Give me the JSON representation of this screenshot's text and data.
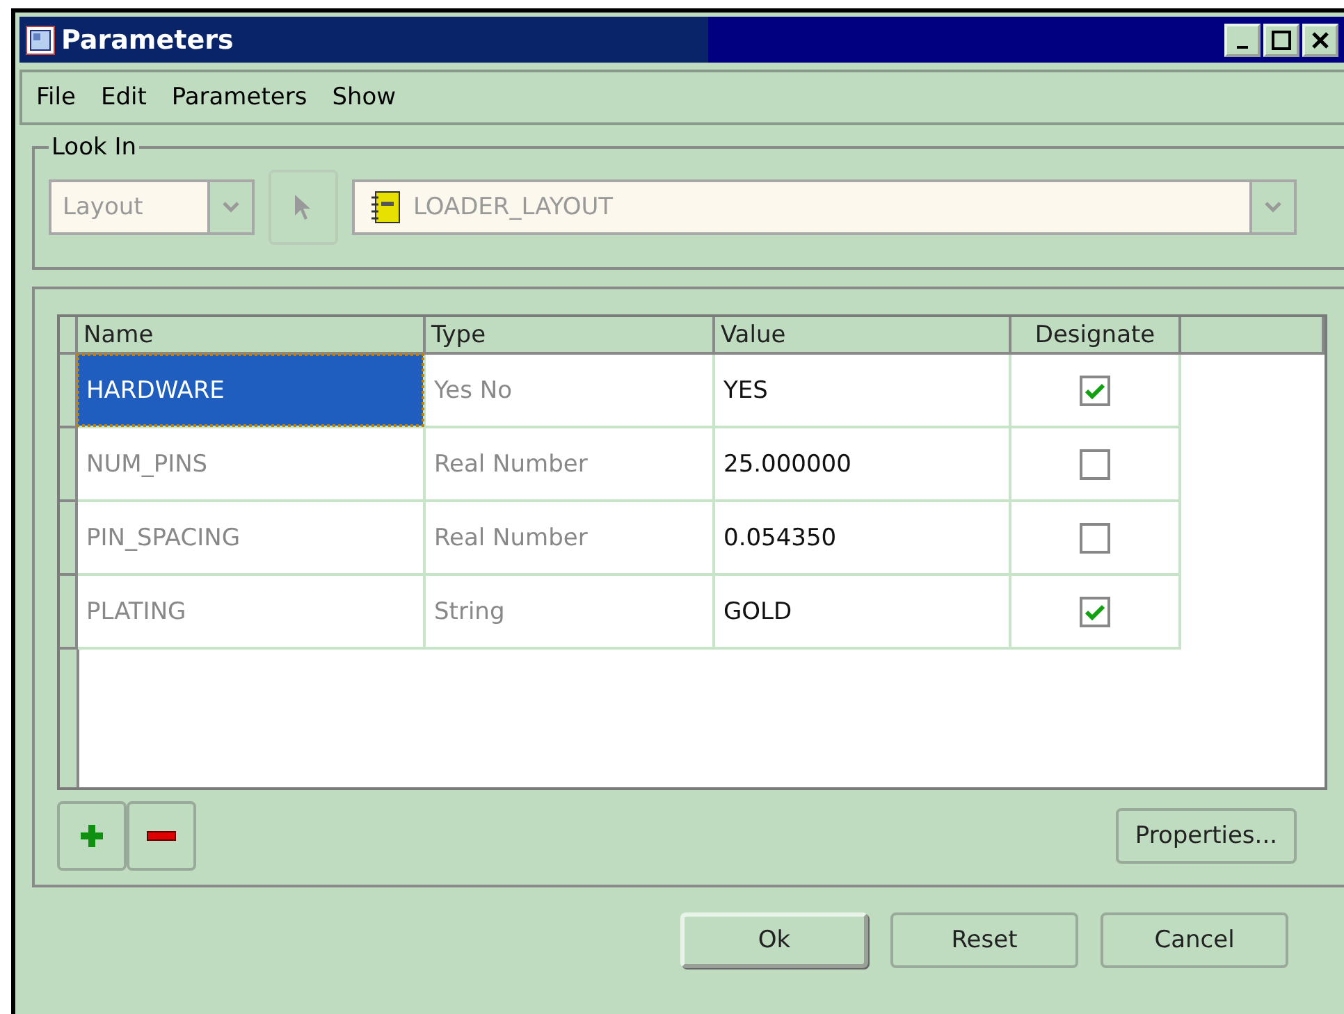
{
  "window": {
    "title": "Parameters"
  },
  "menu": [
    "File",
    "Edit",
    "Parameters",
    "Show"
  ],
  "look_in": {
    "label": "Look In",
    "context": {
      "value": "Layout",
      "disabled": true
    },
    "object": {
      "value": "LOADER_LAYOUT",
      "disabled": true
    }
  },
  "table": {
    "columns": [
      "Name",
      "Type",
      "Value",
      "Designate"
    ],
    "rows": [
      {
        "name": "HARDWARE",
        "type": "Yes No",
        "value": "YES",
        "designate": true,
        "selected": true
      },
      {
        "name": "NUM_PINS",
        "type": "Real Number",
        "value": "25.000000",
        "designate": false,
        "selected": false
      },
      {
        "name": "PIN_SPACING",
        "type": "Real Number",
        "value": "0.054350",
        "designate": false,
        "selected": false
      },
      {
        "name": "PLATING",
        "type": "String",
        "value": "GOLD",
        "designate": true,
        "selected": false
      }
    ]
  },
  "properties_button": "Properties...",
  "buttons": [
    {
      "label": "Ok",
      "kind": "default"
    },
    {
      "label": "Reset",
      "kind": "normal"
    },
    {
      "label": "Cancel",
      "kind": "normal"
    }
  ]
}
